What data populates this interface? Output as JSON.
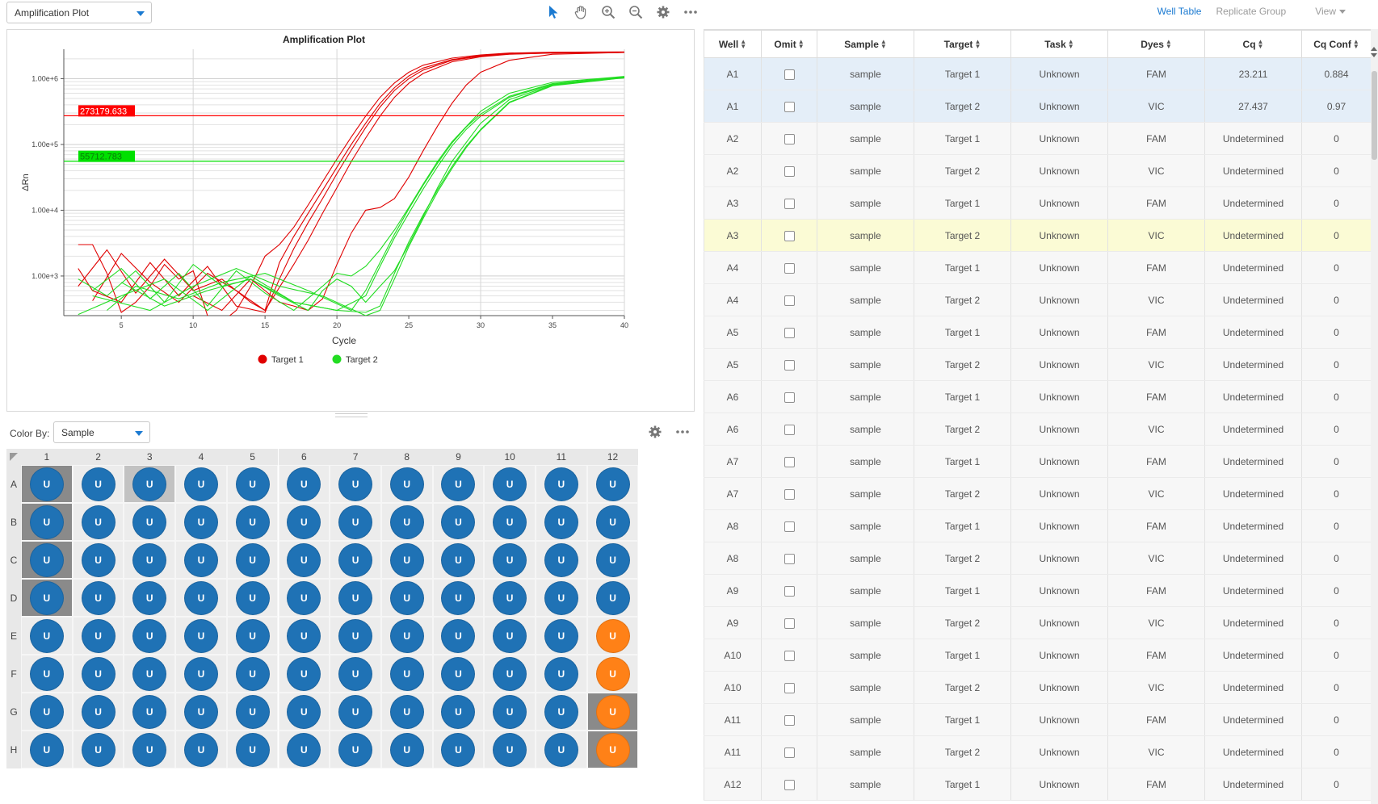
{
  "toolbar": {
    "view_select": "Amplification Plot",
    "icons": [
      "pointer-icon",
      "pan-icon",
      "zoom-in-icon",
      "zoom-out-icon",
      "gear-icon",
      "more-icon"
    ]
  },
  "plot": {
    "title": "Amplification Plot",
    "xlabel": "Cycle",
    "ylabel": "ΔRn",
    "x_ticks": [
      "5",
      "10",
      "15",
      "20",
      "25",
      "30",
      "35",
      "40"
    ],
    "y_ticks": [
      "1.00e+6",
      "1.00e+5",
      "1.00e+4",
      "1.00e+3"
    ],
    "threshold_labels": [
      "273179.633",
      "55712.783"
    ],
    "legend": [
      "Target 1",
      "Target 2"
    ]
  },
  "chart_data": {
    "type": "line",
    "title": "Amplification Plot",
    "xlabel": "Cycle",
    "ylabel": "ΔRn",
    "xlim": [
      1,
      40
    ],
    "ylim": [
      250,
      2800000
    ],
    "log_y": true,
    "grid": true,
    "legend_position": "bottom",
    "thresholds": [
      {
        "series": "Target 1",
        "value": 273179.633,
        "color": "#ff0000"
      },
      {
        "series": "Target 2",
        "value": 55712.783,
        "color": "#00e000"
      }
    ],
    "series": [
      {
        "name": "Target 1",
        "color": "#e00000",
        "curves": [
          {
            "x": [
              2,
              3,
              4,
              5,
              6,
              7,
              8,
              9,
              10,
              11,
              12,
              13,
              14,
              15,
              16,
              17,
              18,
              19,
              20,
              21,
              22,
              23,
              24,
              25,
              26,
              28,
              30,
              32,
              35,
              40
            ],
            "y": [
              3000,
              3000,
              1100,
              280,
              400,
              700,
              1500,
              900,
              1200,
              250,
              200,
              300,
              700,
              2000,
              3000,
              5500,
              12000,
              27000,
              60000,
              130000,
              270000,
              520000,
              860000,
              1250000,
              1600000,
              2050000,
              2300000,
              2450000,
              2520000,
              2550000
            ]
          },
          {
            "x": [
              2,
              4,
              6,
              8,
              10,
              12,
              14,
              15,
              16,
              17,
              18,
              19,
              20,
              21,
              22,
              23,
              24,
              25,
              26,
              28,
              30,
              32,
              35,
              40
            ],
            "y": [
              700,
              2500,
              550,
              1800,
              600,
              900,
              400,
              300,
              1600,
              4000,
              9000,
              20000,
              45000,
              100000,
              210000,
              420000,
              730000,
              1100000,
              1450000,
              1950000,
              2250000,
              2400000,
              2480000,
              2520000
            ]
          },
          {
            "x": [
              2,
              3,
              5,
              7,
              9,
              11,
              13,
              15,
              16,
              17,
              18,
              19,
              20,
              21,
              22,
              23,
              24,
              25,
              26,
              28,
              30,
              32,
              35,
              40
            ],
            "y": [
              1300,
              600,
              400,
              1600,
              500,
              1400,
              350,
              280,
              900,
              2600,
              6500,
              15000,
              36000,
              82000,
              180000,
              370000,
              660000,
              1000000,
              1350000,
              1900000,
              2200000,
              2370000,
              2460000,
              2510000
            ]
          },
          {
            "x": [
              3,
              5,
              7,
              9,
              11,
              13,
              15,
              17,
              18,
              19,
              20,
              21,
              22,
              23,
              24,
              25,
              26,
              28,
              30,
              32,
              35,
              40
            ],
            "y": [
              420,
              2200,
              800,
              400,
              1100,
              600,
              300,
              1500,
              3500,
              9000,
              22000,
              55000,
              125000,
              270000,
              520000,
              850000,
              1200000,
              1800000,
              2150000,
              2350000,
              2450000,
              2500000
            ]
          },
          {
            "x": [
              10,
              12,
              14,
              15,
              16,
              17,
              18,
              19,
              20,
              21,
              22,
              23,
              24,
              25,
              26,
              27,
              28,
              29,
              30,
              32,
              35,
              40
            ],
            "y": [
              500,
              300,
              900,
              600,
              400,
              350,
              300,
              450,
              1500,
              4500,
              10000,
              11000,
              15000,
              32000,
              80000,
              190000,
              420000,
              800000,
              1250000,
              1900000,
              2350000,
              2500000
            ]
          }
        ]
      },
      {
        "name": "Target 2",
        "color": "#22dd22",
        "curves": [
          {
            "x": [
              2,
              4,
              6,
              8,
              10,
              12,
              14,
              16,
              18,
              19,
              20,
              21,
              22,
              23,
              24,
              25,
              26,
              27,
              28,
              30,
              32,
              35,
              40
            ],
            "y": [
              900,
              500,
              1200,
              400,
              1500,
              700,
              900,
              500,
              300,
              600,
              900,
              700,
              400,
              700,
              1200,
              3000,
              8000,
              22000,
              55000,
              210000,
              480000,
              800000,
              1050000
            ]
          },
          {
            "x": [
              3,
              5,
              7,
              9,
              11,
              13,
              15,
              17,
              19,
              20,
              21,
              22,
              23,
              24,
              25,
              26,
              27,
              28,
              30,
              32,
              35,
              40
            ],
            "y": [
              600,
              1300,
              450,
              1100,
              350,
              1200,
              550,
              300,
              700,
              1100,
              1000,
              1400,
              2500,
              5000,
              11000,
              25000,
              55000,
              110000,
              320000,
              600000,
              880000,
              1080000
            ]
          },
          {
            "x": [
              2,
              5,
              8,
              11,
              14,
              17,
              20,
              22,
              23,
              24,
              25,
              26,
              27,
              28,
              29,
              30,
              32,
              35,
              40
            ],
            "y": [
              260,
              500,
              900,
              300,
              1000,
              400,
              300,
              500,
              1400,
              3800,
              9000,
              21000,
              46000,
              95000,
              170000,
              270000,
              520000,
              820000,
              1050000
            ]
          },
          {
            "x": [
              4,
              6,
              9,
              12,
              15,
              18,
              21,
              22,
              23,
              24,
              25,
              26,
              27,
              28,
              29,
              30,
              32,
              35,
              40
            ],
            "y": [
              300,
              700,
              450,
              800,
              1100,
              600,
              300,
              600,
              1600,
              4300,
              10500,
              24000,
              52000,
              105000,
              185000,
              290000,
              540000,
              840000,
              1070000
            ]
          },
          {
            "x": [
              3,
              7,
              10,
              13,
              16,
              19,
              22,
              23,
              24,
              25,
              26,
              27,
              28,
              29,
              30,
              32,
              35,
              40
            ],
            "y": [
              500,
              300,
              700,
              1300,
              700,
              500,
              250,
              300,
              900,
              2800,
              7500,
              19000,
              43000,
              90000,
              165000,
              430000,
              780000,
              1030000
            ]
          },
          {
            "x": [
              5,
              8,
              11,
              14,
              17,
              20,
              22,
              23,
              24,
              25,
              26,
              27,
              28,
              29,
              30,
              32,
              35,
              40
            ],
            "y": [
              800,
              350,
              600,
              900,
              400,
              300,
              280,
              350,
              1100,
              3300,
              8500,
              20500,
              46000,
              94000,
              170000,
              440000,
              790000,
              1040000
            ]
          }
        ]
      }
    ]
  },
  "plate": {
    "color_by_label": "Color By:",
    "color_by_value": "Sample",
    "columns": [
      "1",
      "2",
      "3",
      "4",
      "5",
      "6",
      "7",
      "8",
      "9",
      "10",
      "11",
      "12"
    ],
    "rows": [
      "A",
      "B",
      "C",
      "D",
      "E",
      "F",
      "G",
      "H"
    ],
    "well_label": "U",
    "blue": "#1f72b5",
    "orange": "#ff8117",
    "orange_wells": [
      "E12",
      "F12",
      "G12",
      "H12"
    ],
    "dark_selected_wells": [
      "A1",
      "B1",
      "C1",
      "D1",
      "G12",
      "H12"
    ],
    "light_selected_wells": [
      "A3"
    ]
  },
  "right": {
    "links": {
      "well_table": "Well Table",
      "replicate_group": "Replicate Group",
      "view": "View"
    },
    "columns": [
      "Well",
      "Omit",
      "Sample",
      "Target",
      "Task",
      "Dyes",
      "Cq",
      "Cq Conf"
    ],
    "rows": [
      {
        "well": "A1",
        "sample": "sample",
        "target": "Target 1",
        "task": "Unknown",
        "dye": "FAM",
        "cq": "23.211",
        "conf": "0.884",
        "state": "sel"
      },
      {
        "well": "A1",
        "sample": "sample",
        "target": "Target 2",
        "task": "Unknown",
        "dye": "VIC",
        "cq": "27.437",
        "conf": "0.97",
        "state": "sel"
      },
      {
        "well": "A2",
        "sample": "sample",
        "target": "Target 1",
        "task": "Unknown",
        "dye": "FAM",
        "cq": "Undetermined",
        "conf": "0",
        "state": "norm"
      },
      {
        "well": "A2",
        "sample": "sample",
        "target": "Target 2",
        "task": "Unknown",
        "dye": "VIC",
        "cq": "Undetermined",
        "conf": "0",
        "state": "norm"
      },
      {
        "well": "A3",
        "sample": "sample",
        "target": "Target 1",
        "task": "Unknown",
        "dye": "FAM",
        "cq": "Undetermined",
        "conf": "0",
        "state": "norm"
      },
      {
        "well": "A3",
        "sample": "sample",
        "target": "Target 2",
        "task": "Unknown",
        "dye": "VIC",
        "cq": "Undetermined",
        "conf": "0",
        "state": "hl"
      },
      {
        "well": "A4",
        "sample": "sample",
        "target": "Target 1",
        "task": "Unknown",
        "dye": "FAM",
        "cq": "Undetermined",
        "conf": "0",
        "state": "norm"
      },
      {
        "well": "A4",
        "sample": "sample",
        "target": "Target 2",
        "task": "Unknown",
        "dye": "VIC",
        "cq": "Undetermined",
        "conf": "0",
        "state": "norm"
      },
      {
        "well": "A5",
        "sample": "sample",
        "target": "Target 1",
        "task": "Unknown",
        "dye": "FAM",
        "cq": "Undetermined",
        "conf": "0",
        "state": "norm"
      },
      {
        "well": "A5",
        "sample": "sample",
        "target": "Target 2",
        "task": "Unknown",
        "dye": "VIC",
        "cq": "Undetermined",
        "conf": "0",
        "state": "norm"
      },
      {
        "well": "A6",
        "sample": "sample",
        "target": "Target 1",
        "task": "Unknown",
        "dye": "FAM",
        "cq": "Undetermined",
        "conf": "0",
        "state": "norm"
      },
      {
        "well": "A6",
        "sample": "sample",
        "target": "Target 2",
        "task": "Unknown",
        "dye": "VIC",
        "cq": "Undetermined",
        "conf": "0",
        "state": "norm"
      },
      {
        "well": "A7",
        "sample": "sample",
        "target": "Target 1",
        "task": "Unknown",
        "dye": "FAM",
        "cq": "Undetermined",
        "conf": "0",
        "state": "norm"
      },
      {
        "well": "A7",
        "sample": "sample",
        "target": "Target 2",
        "task": "Unknown",
        "dye": "VIC",
        "cq": "Undetermined",
        "conf": "0",
        "state": "norm"
      },
      {
        "well": "A8",
        "sample": "sample",
        "target": "Target 1",
        "task": "Unknown",
        "dye": "FAM",
        "cq": "Undetermined",
        "conf": "0",
        "state": "norm"
      },
      {
        "well": "A8",
        "sample": "sample",
        "target": "Target 2",
        "task": "Unknown",
        "dye": "VIC",
        "cq": "Undetermined",
        "conf": "0",
        "state": "norm"
      },
      {
        "well": "A9",
        "sample": "sample",
        "target": "Target 1",
        "task": "Unknown",
        "dye": "FAM",
        "cq": "Undetermined",
        "conf": "0",
        "state": "norm"
      },
      {
        "well": "A9",
        "sample": "sample",
        "target": "Target 2",
        "task": "Unknown",
        "dye": "VIC",
        "cq": "Undetermined",
        "conf": "0",
        "state": "norm"
      },
      {
        "well": "A10",
        "sample": "sample",
        "target": "Target 1",
        "task": "Unknown",
        "dye": "FAM",
        "cq": "Undetermined",
        "conf": "0",
        "state": "norm"
      },
      {
        "well": "A10",
        "sample": "sample",
        "target": "Target 2",
        "task": "Unknown",
        "dye": "VIC",
        "cq": "Undetermined",
        "conf": "0",
        "state": "norm"
      },
      {
        "well": "A11",
        "sample": "sample",
        "target": "Target 1",
        "task": "Unknown",
        "dye": "FAM",
        "cq": "Undetermined",
        "conf": "0",
        "state": "norm"
      },
      {
        "well": "A11",
        "sample": "sample",
        "target": "Target 2",
        "task": "Unknown",
        "dye": "VIC",
        "cq": "Undetermined",
        "conf": "0",
        "state": "norm"
      },
      {
        "well": "A12",
        "sample": "sample",
        "target": "Target 1",
        "task": "Unknown",
        "dye": "FAM",
        "cq": "Undetermined",
        "conf": "0",
        "state": "norm"
      }
    ]
  },
  "colors": {
    "accent": "#1b7ad1",
    "target1": "#ff0000",
    "target2": "#00e000"
  }
}
